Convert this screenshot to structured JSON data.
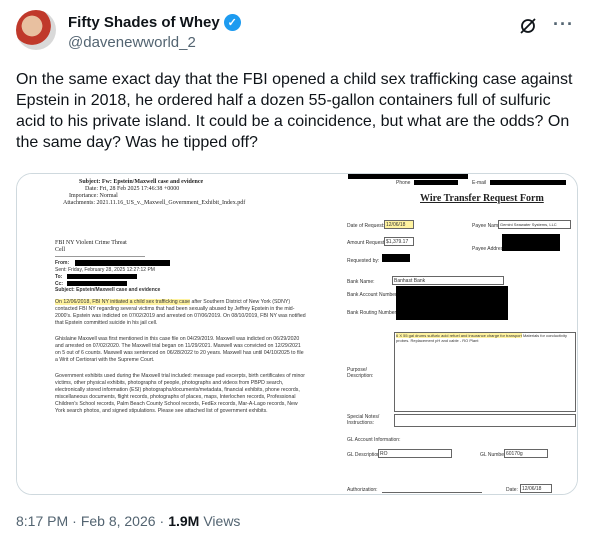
{
  "author": {
    "display_name": "Fifty Shades of Whey",
    "handle": "@davenewworld_2",
    "verified": true
  },
  "icons": {
    "verified": "verified-badge-icon",
    "grok": "grok-icon",
    "more": "more-icon"
  },
  "tweet": {
    "text": "On the same exact day that the FBI opened a child sex trafficking case against Epstein in 2018, he ordered half a dozen 55-gallon containers full of sulfuric acid to his private island. It could be a coincidence, but what are the odds? On the same day? Was he tipped off?"
  },
  "left_doc": {
    "subject": "Subject: Fw: Epstein/Maxwell case and evidence",
    "date": "Date: Fri, 28 Feb 2025 17:46:38 +0000",
    "importance": "Importance: Normal",
    "attachments": "Attachments: 2021.11.16_US_v._Maxwell_Government_Exhibit_Index.pdf",
    "org": "FBI NY Violent Crime Threat",
    "cell": "Cell",
    "from": "From:",
    "sent": "Sent: Friday, February 28, 2025 12:27:12 PM",
    "to": "To:",
    "cc": "Cc:",
    "subject2": "Subject: Epstein/Maxwell case and evidence",
    "para1_hl": "On 12/06/2018, FBI NY initiated a child sex trafficking case",
    "para1_rest": " after Southern District of New York (SDNY) contacted FBI NY regarding several victims that had been sexually abused by Jeffrey Epstein in the mid-2000's. Epstein was indicted on 07/02/2019 and arrested on 07/06/2019. On 08/10/2019, FBI NY was notified that Epstein committed suicide in his jail cell.",
    "para2": "Ghislaine Maxwell was first mentioned in this case file on 04/29/2019. Maxwell was indicted on 06/29/2020 and arrested on 07/02/2020. The Maxwell trial began on 11/29/2021. Maxwell was convicted on 12/29/2021 on 5 out of 6 counts. Maxwell was sentenced on 06/28/2022 to 20 years. Maxwell has until 04/10/2025 to file a Writ of Certiorari with the Supreme Court.",
    "para3": "Government exhibits used during the Maxwell trial included: message pad excerpts, birth certificates of minor victims, other physical exhibits, photographs of people, photographs and videos from PBPD search, electronically stored information (ESI) photographs/documents/metadata, financial exhibits, phone records, miscellaneous documents, flight records, photographs of places, maps, Interlochen records, Professional Children's School records, Palm Beach County School records, FedEx records, Mar-A-Lago records, New York search photos, and signed stipulations. Please see attached list of government exhibits."
  },
  "right_doc": {
    "header_phone": "Phone",
    "header_email": "E-mail",
    "title": "Wire Transfer Request Form",
    "date_label": "Date of Request:",
    "date_value": "12/06/18",
    "payee_name_label": "Payee Name:",
    "payee_name_value": "Gemini Seawater Systems, LLC",
    "amount_label": "Amount Requested:",
    "amount_value": "$1,379.17",
    "payee_address_label": "Payee Address:",
    "requested_by_label": "Requested by:",
    "bank_name_label": "Bank Name:",
    "bank_name_value": "Banhast Bank",
    "bank_account_label": "Bank Account Number:",
    "bank_routing_label": "Bank Routing Number:",
    "purpose_label": "Purpose/ Description:",
    "purpose_hl": "6 X 55 gal drums sulfuric acid refuel and insurance charge for transport",
    "purpose_rest": " Materials for conductivity probes. Replacement pH and cable - RO Plant",
    "special_label": "Special Notes/ Instructions:",
    "gl_account_label": "GL Account Information:",
    "gl_desc_label": "GL Description:",
    "gl_desc_value": "RO",
    "gl_number_label": "GL Number:",
    "gl_number_value": "60170g",
    "authorization_label": "Authorization:",
    "date2_label": "Date:",
    "date2_value": "12/06/18"
  },
  "meta": {
    "time": "8:17 PM",
    "separator": "·",
    "date": "Feb 8, 2026",
    "views_count": "1.9M",
    "views_label": "Views"
  }
}
